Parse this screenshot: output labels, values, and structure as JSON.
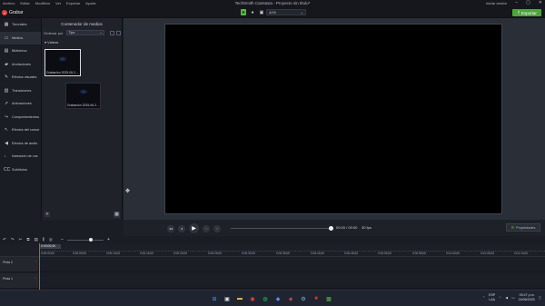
{
  "titlebar": {
    "menu": [
      "Archivo",
      "Editar",
      "Modificar",
      "Ver",
      "Exportar",
      "Ayuda"
    ],
    "title": "TechSmith Camtasia - Proyecto sin título*",
    "login": "Iniciar sesión"
  },
  "toolbar": {
    "record_label": "Grabar",
    "zoom": "41%",
    "export_label": "Exportar"
  },
  "sidebar": {
    "items": [
      {
        "icon": "grid-icon",
        "label": "Tutoriales"
      },
      {
        "icon": "media-icon",
        "label": "Medios"
      },
      {
        "icon": "library-icon",
        "label": "Biblioteca"
      },
      {
        "icon": "annotation-icon",
        "label": "Anotaciones"
      },
      {
        "icon": "visual-effects-icon",
        "label": "Efectos visuales"
      },
      {
        "icon": "transition-icon",
        "label": "Transiciones"
      },
      {
        "icon": "animation-icon",
        "label": "Animaciones"
      },
      {
        "icon": "behavior-icon",
        "label": "Comportamientos"
      },
      {
        "icon": "cursor-effects-icon",
        "label": "Efectos del cursor"
      },
      {
        "icon": "audio-effects-icon",
        "label": "Efectos de audio"
      },
      {
        "icon": "narration-icon",
        "label": "Narración de voz"
      },
      {
        "icon": "captions-icon",
        "label": "Subtítulos"
      }
    ]
  },
  "media_bin": {
    "title": "Contenedor de medios",
    "sort_label": "Ordenar por",
    "sort_value": "Tipo",
    "section": "Videos",
    "items": [
      {
        "caption": "Grabación 2025-06-2..."
      },
      {
        "caption": "Grabación 2025-06-2..."
      }
    ]
  },
  "playback": {
    "timecode": "00:00 / 00:00",
    "fps": "30 fps",
    "properties_label": "Propiedades"
  },
  "timeline": {
    "playhead": "0:00:00;00",
    "ticks": [
      "0:00:00;00",
      "0:00:05;00",
      "0:00:10;00",
      "0:00:15;00",
      "0:00:20;00",
      "0:00:25;00",
      "0:00:30;00",
      "0:00:35;00",
      "0:00:40;00",
      "0:00:45;00",
      "0:00:50;00",
      "0:00:55;00",
      "0:01:00;00",
      "0:01:05;00",
      "0:01:10;00"
    ],
    "tracks": [
      "Pista 2",
      "Pista 1"
    ]
  },
  "taskbar": {
    "lang": "ESP",
    "region": "LAA",
    "time": "09:27 p.m.",
    "date": "24/06/2025"
  }
}
